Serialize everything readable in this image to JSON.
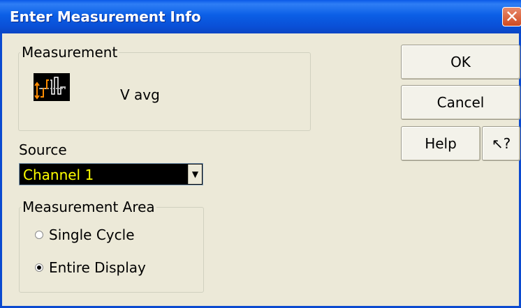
{
  "window": {
    "title": "Enter Measurement Info",
    "close_glyph": "✕"
  },
  "measurement": {
    "group_label": "Measurement",
    "icon": "v-avg-measurement-icon",
    "name": "V avg"
  },
  "source": {
    "label": "Source",
    "selected": "Channel 1",
    "dropdown_glyph": "▼"
  },
  "measurement_area": {
    "group_label": "Measurement Area",
    "options": [
      {
        "label": "Single Cycle",
        "checked": false
      },
      {
        "label": "Entire Display",
        "checked": true
      }
    ]
  },
  "buttons": {
    "ok": "OK",
    "cancel": "Cancel",
    "help": "Help",
    "whats_this": "↖?"
  },
  "colors": {
    "titlebar": "#0b5fe6",
    "dialog_bg": "#ece9d8",
    "select_bg": "#000000",
    "select_text": "#ffff00",
    "icon_trace": "#ff8c00"
  }
}
